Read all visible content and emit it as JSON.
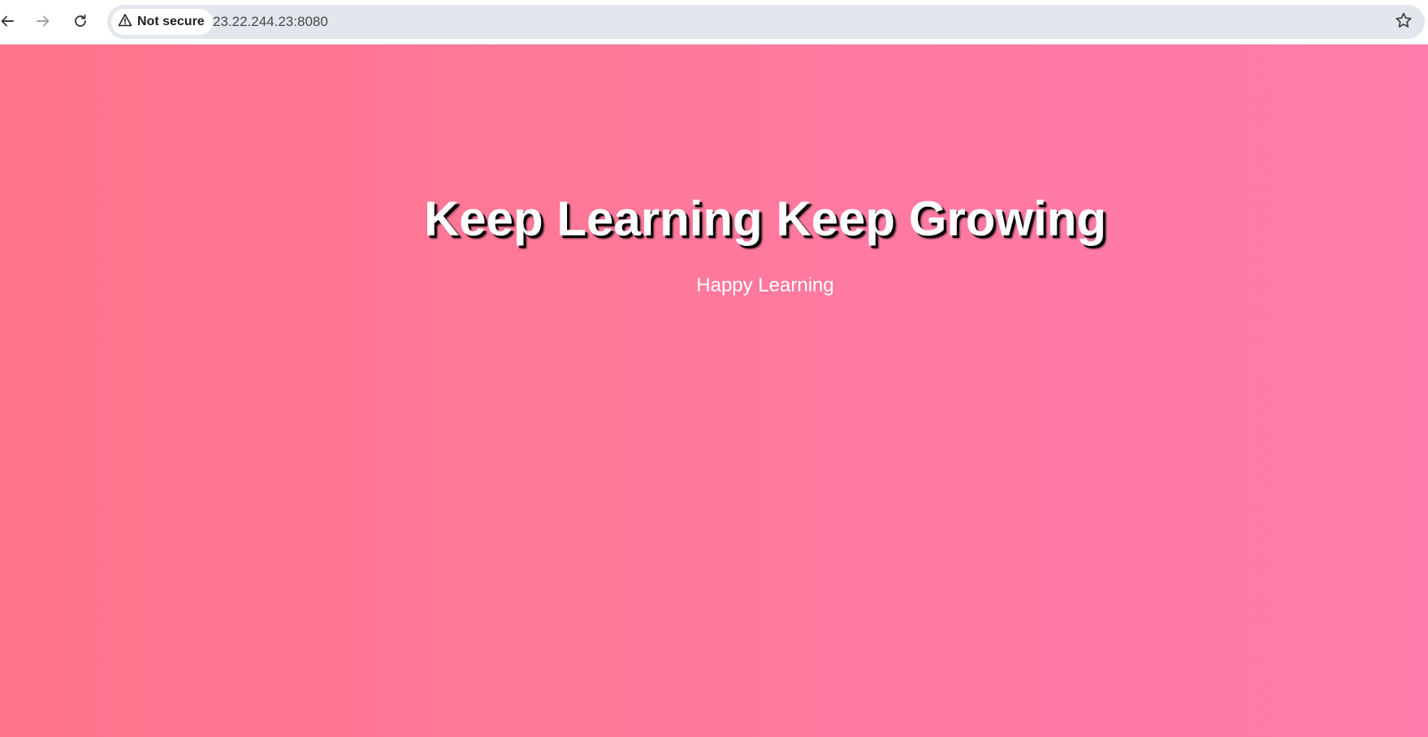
{
  "browser": {
    "security_label": "Not secure",
    "url": "23.22.244.23:8080",
    "icons": {
      "back": "back-arrow-icon",
      "forward": "forward-arrow-icon",
      "reload": "reload-icon",
      "warning": "warning-triangle-icon",
      "bookmark": "star-icon"
    }
  },
  "page": {
    "headline": "Keep Learning Keep Growing",
    "subtext": "Happy Learning",
    "colors": {
      "background_start": "#ff748b",
      "background_end": "#ff7bab",
      "text": "#ffffff",
      "text_shadow": "#000000"
    }
  }
}
